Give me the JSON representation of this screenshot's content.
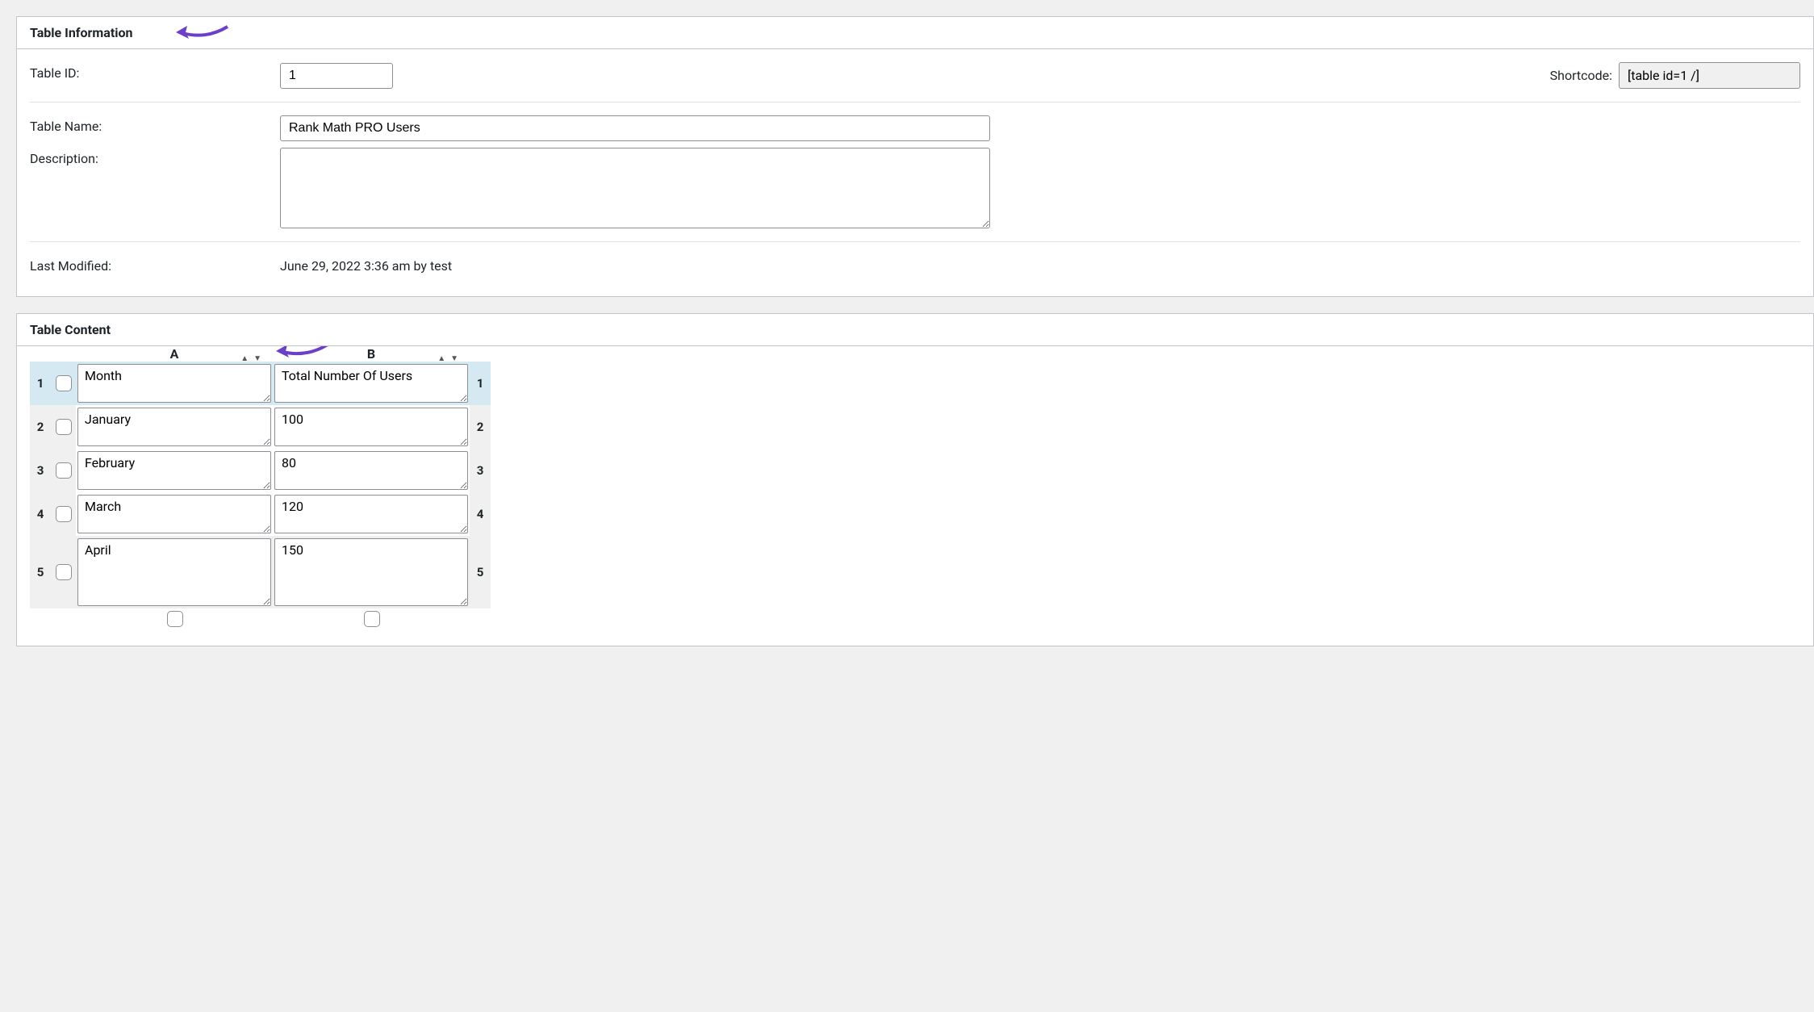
{
  "info_panel": {
    "title": "Table Information",
    "table_id_label": "Table ID:",
    "table_id_value": "1",
    "shortcode_label": "Shortcode:",
    "shortcode_value": "[table id=1 /]",
    "table_name_label": "Table Name:",
    "table_name_value": "Rank Math PRO Users",
    "description_label": "Description:",
    "description_value": "",
    "last_modified_label": "Last Modified:",
    "last_modified_value": "June 29, 2022 3:36 am by test"
  },
  "content_panel": {
    "title": "Table Content",
    "columns": [
      "A",
      "B"
    ],
    "rows": [
      {
        "num": "1",
        "cells": [
          "Month",
          "Total Number Of Users"
        ],
        "head": true
      },
      {
        "num": "2",
        "cells": [
          "January",
          "100"
        ]
      },
      {
        "num": "3",
        "cells": [
          "February",
          "80"
        ]
      },
      {
        "num": "4",
        "cells": [
          "March",
          "120"
        ]
      },
      {
        "num": "5",
        "cells": [
          "April",
          "150"
        ],
        "last": true
      }
    ]
  },
  "chart_data": {
    "type": "table",
    "columns": [
      "Month",
      "Total Number Of Users"
    ],
    "rows": [
      [
        "January",
        100
      ],
      [
        "February",
        80
      ],
      [
        "March",
        120
      ],
      [
        "April",
        150
      ]
    ]
  }
}
